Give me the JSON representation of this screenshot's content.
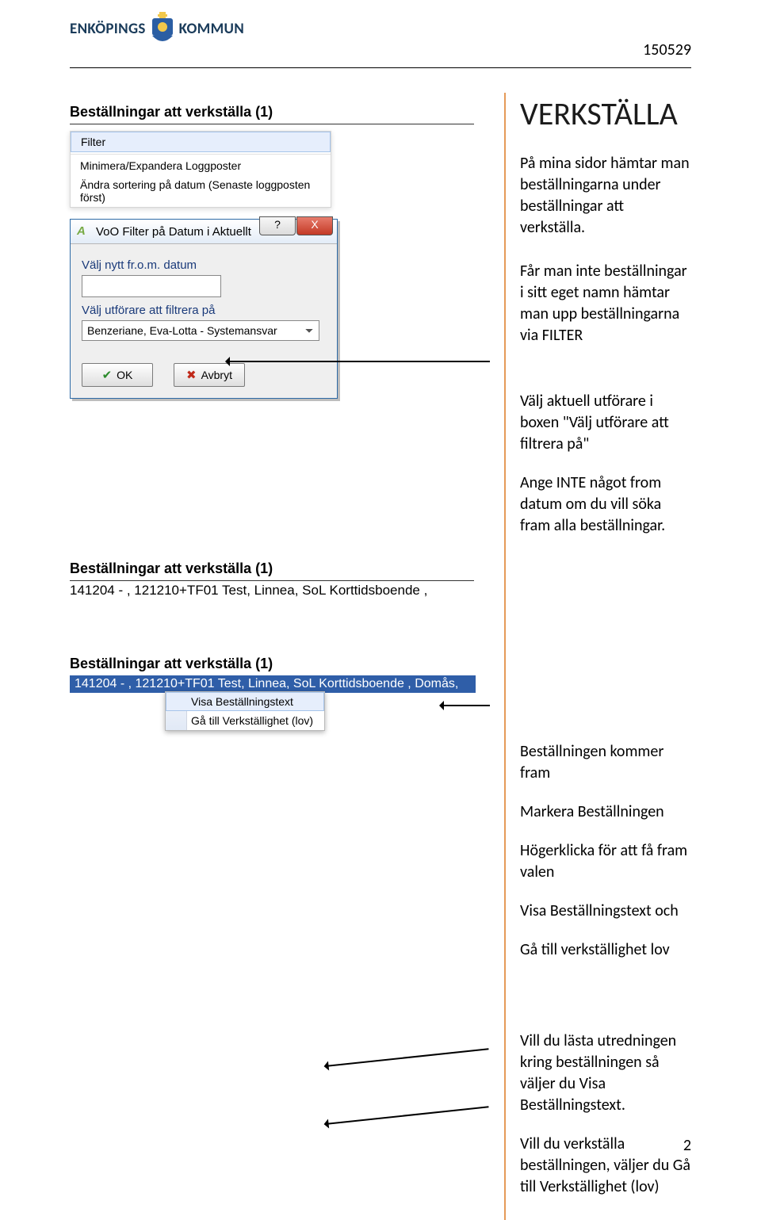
{
  "header": {
    "logo_left": "ENKÖPINGS",
    "logo_right": "KOMMUN",
    "doc_date": "150529"
  },
  "right": {
    "title": "VERKSTÄLLA",
    "p1": "På mina sidor hämtar man beställningarna under beställningar att verkställa.",
    "p2": "Får man inte beställningar i sitt eget namn hämtar man upp beställningarna via FILTER",
    "p3": "Välj aktuell utförare i boxen \"Välj utförare att filtrera på\"",
    "p4": "Ange INTE något from datum om du vill söka fram alla beställningar.",
    "p5": "Beställningen kommer fram",
    "p6": "Markera Beställningen",
    "p7": "Högerklicka för att få fram valen",
    "p8": "Visa Beställningstext och",
    "p9": "Gå till verkställighet lov",
    "p10": "Vill du lästa utredningen kring beställningen så väljer du Visa Beställningstext.",
    "p11": "Vill du verkställa beställningen, väljer du Gå till Verkställighet (lov)"
  },
  "panel1": {
    "heading": "Beställningar att verkställa   (1)",
    "ctx": {
      "item1": "Filter",
      "item2": "Minimera/Expandera Loggposter",
      "item3": "Ändra sortering på datum (Senaste loggposten först)"
    }
  },
  "dlg": {
    "title": "VoO Filter på Datum i Aktuellt",
    "help": "?",
    "close": "X",
    "label1": "Välj nytt fr.o.m. datum",
    "label2": "Välj utförare att filtrera på",
    "select_value": "Benzeriane, Eva-Lotta - Systemansvar",
    "ok": "OK",
    "cancel": "Avbryt"
  },
  "panel2": {
    "heading": "Beställningar att verkställa   (1)",
    "row": "141204 -  , 121210+TF01 Test, Linnea, SoL Korttidsboende ,"
  },
  "panel3": {
    "heading": "Beställningar att verkställa   (1)",
    "row": "141204 -  , 121210+TF01 Test, Linnea, SoL Korttidsboende , Domås,",
    "ctx1": "Visa Beställningstext",
    "ctx2": "Gå till Verkställighet (lov)"
  },
  "page_number": "2"
}
